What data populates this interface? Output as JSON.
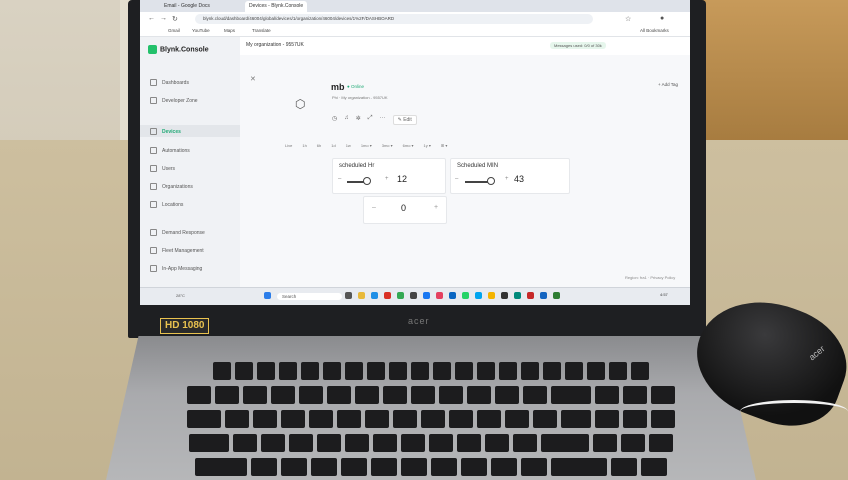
{
  "browser": {
    "tabs": [
      {
        "label": "Email - Google Docs"
      },
      {
        "label": "Devices - Blynk.Console"
      }
    ],
    "url": "blynk.cloud/dashboard/46004/global/devices/1/organization/46004/devices/1%2F/DASHBOARD",
    "bookmarks": [
      "Gmail",
      "YouTube",
      "Maps",
      "Translate"
    ],
    "all_bookmarks": "All Bookmarks"
  },
  "app": {
    "logo": "Blynk.Console",
    "org": "My organization - 9557UK",
    "messages_badge": "Messages used: 0/0 of 30k",
    "nav": {
      "dashboards": "Dashboards",
      "developer_zone": "Developer Zone",
      "devices": "Devices",
      "automations": "Automations",
      "users": "Users",
      "organizations": "Organizations",
      "locations": "Locations",
      "demand_response": "Demand Response",
      "fleet_management": "Fleet Management",
      "in_app_messaging": "In-App Messaging"
    }
  },
  "device": {
    "name": "mb",
    "status": "Online",
    "meta": "Phi   ·   My organization - 9557UK",
    "edit_label": "Edit",
    "add_tag": "+ Add Tag",
    "time_ranges": [
      "Live",
      "1h",
      "6h",
      "1d",
      "1w",
      "1mo ▾",
      "3mo ▾",
      "6mo ▾",
      "1y ▾",
      "⊞ ▾"
    ]
  },
  "widgets": {
    "hr": {
      "title": "scheduled Hr",
      "value": "12",
      "minus": "–",
      "plus": "+"
    },
    "min": {
      "title": "Scheduled MIN",
      "value": "43",
      "minus": "–",
      "plus": "+"
    },
    "stepper": {
      "value": "0",
      "minus": "–",
      "plus": "+"
    }
  },
  "footer_note": "Region: fra1 · Privacy Policy",
  "taskbar": {
    "weather": "28°C",
    "search": "Search",
    "clock": "4:57"
  },
  "hardware": {
    "badge": "HD 1080",
    "laptop_brand": "acer",
    "mouse_brand": "acer"
  }
}
